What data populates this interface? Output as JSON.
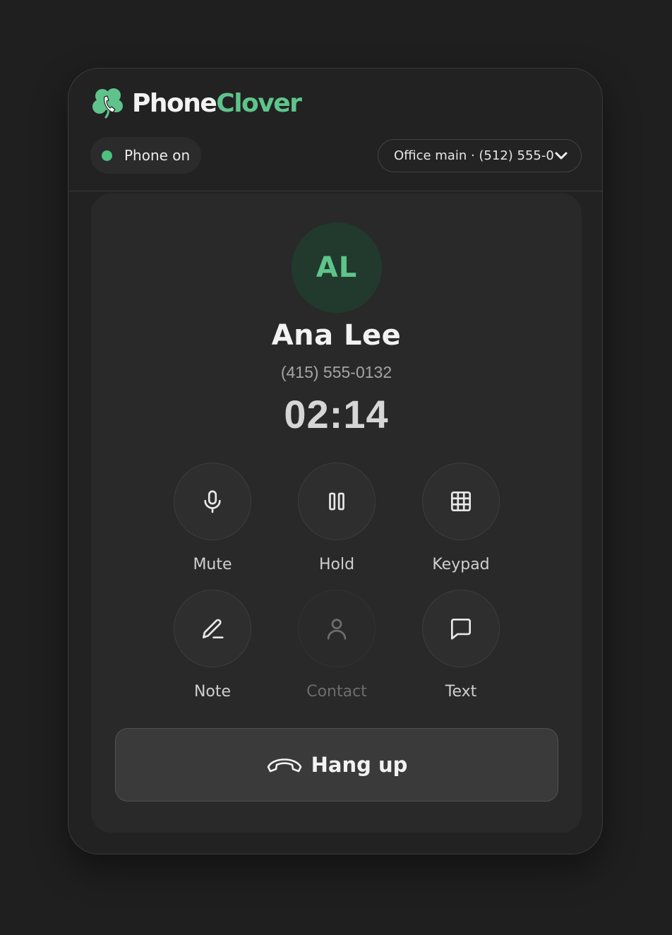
{
  "brand": {
    "name_part1": "Phone",
    "name_part2": "Clover",
    "accent": "#5fc48b"
  },
  "status": {
    "label": "Phone on",
    "color": "#4fc07e"
  },
  "line_selector": {
    "value": "Office main · (512) 555-0"
  },
  "call": {
    "initials": "AL",
    "name": "Ana Lee",
    "number": "(415) 555-0132",
    "timer": "02:14"
  },
  "controls": {
    "mute": {
      "label": "Mute",
      "icon": "microphone-icon"
    },
    "hold": {
      "label": "Hold",
      "icon": "pause-icon"
    },
    "keypad": {
      "label": "Keypad",
      "icon": "grid-icon"
    },
    "note": {
      "label": "Note",
      "icon": "pencil-icon"
    },
    "contact": {
      "label": "Contact",
      "icon": "person-icon",
      "disabled": true
    },
    "text": {
      "label": "Text",
      "icon": "chat-bubble-icon"
    }
  },
  "hangup": {
    "label": "Hang up",
    "icon": "phone-hangup-icon"
  }
}
